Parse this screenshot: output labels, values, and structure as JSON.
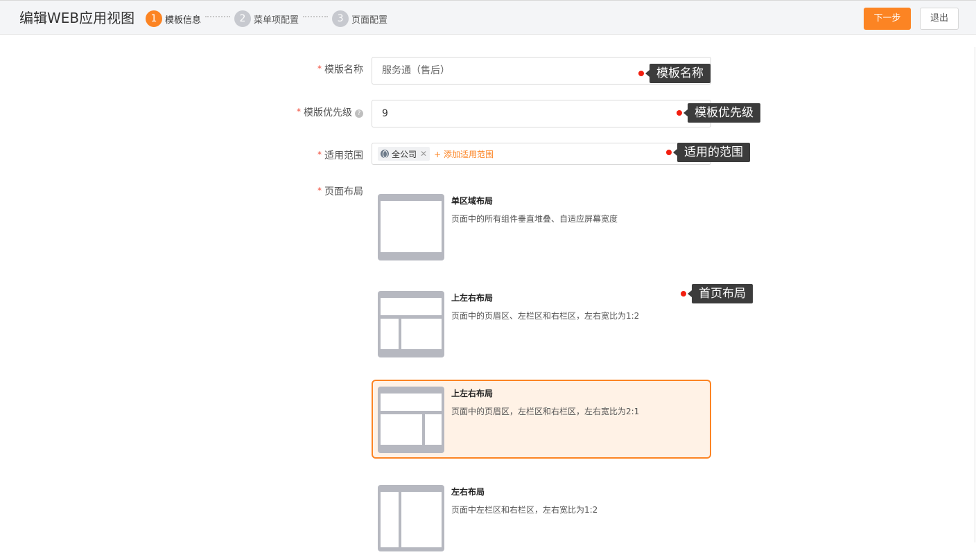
{
  "header": {
    "title": "编辑WEB应用视图",
    "steps": [
      {
        "num": "1",
        "label": "模板信息"
      },
      {
        "num": "2",
        "label": "菜单项配置"
      },
      {
        "num": "3",
        "label": "页面配置"
      }
    ],
    "next_label": "下一步",
    "exit_label": "退出"
  },
  "form": {
    "required_mark": "*",
    "name_label": "模版名称",
    "name_value": "服务通（售后）",
    "priority_label": "模版优先级",
    "priority_value": "9",
    "help_glyph": "?",
    "scope_label": "适用范围",
    "scope_tag": "全公司",
    "scope_tag_close": "✕",
    "scope_add": "+ 添加适用范围",
    "layout_label": "页面布局",
    "layouts": [
      {
        "name": "单区域布局",
        "desc": "页面中的所有组件垂直堆叠、自适应屏幕宽度"
      },
      {
        "name": "上左右布局",
        "desc": "页面中的页眉区、左栏区和右栏区，左右宽比为1:2"
      },
      {
        "name": "上左右布局",
        "desc": "页面中的页眉区，左栏区和右栏区，左右宽比为2:1"
      },
      {
        "name": "左右布局",
        "desc": "页面中左栏区和右栏区，左右宽比为1:2"
      }
    ],
    "selected_layout_index": 2
  },
  "annotations": {
    "template_name": "模板名称",
    "template_priority": "模板优先级",
    "scope": "适用的范围",
    "home_layout": "首页布局"
  },
  "colors": {
    "accent": "#fc8423",
    "selected_bg": "#fff2e6",
    "required": "#f04a38",
    "callout_dot": "#f21e0f",
    "callout_bg": "#3c3c3c"
  }
}
